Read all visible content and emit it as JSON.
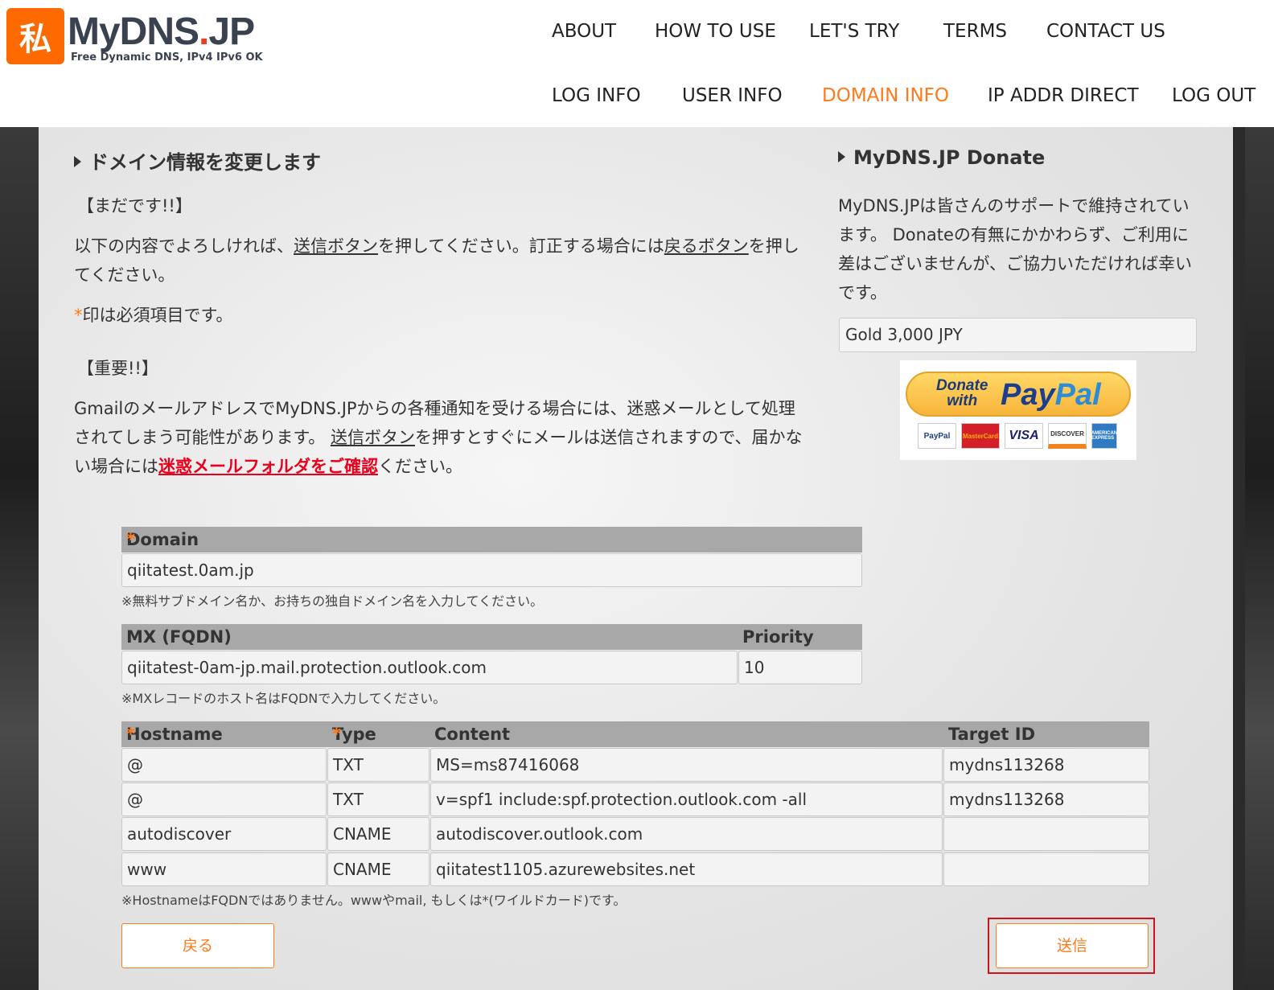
{
  "logo": {
    "mark": "私",
    "name": "MyDNS",
    "dot": ".",
    "tld": "JP",
    "tagline": "Free Dynamic DNS, IPv4 IPv6 OK"
  },
  "nav_top": [
    "ABOUT",
    "HOW TO USE",
    "LET'S TRY",
    "TERMS",
    "CONTACT US"
  ],
  "nav_bottom": [
    "LOG INFO",
    "USER INFO",
    "DOMAIN INFO",
    "IP ADDR DIRECT",
    "LOG OUT"
  ],
  "nav_active": "DOMAIN INFO",
  "left": {
    "heading": "ドメイン情報を変更します",
    "notice1": "【まだです!!】",
    "para1_a": "以下の内容でよろしければ、",
    "para1_link1": "送信ボタン",
    "para1_b": "を押してください。訂正する場合には",
    "para1_link2": "戻るボタン",
    "para1_c": "を押してください。",
    "required_star": "*",
    "required_note": "印は必須項目です。",
    "notice2": "【重要!!】",
    "para2_a": "GmailのメールアドレスでMyDNS.JPからの各種通知を受ける場合には、迷惑メールとして処理されてしまう可能性があります。 ",
    "para2_link": "送信ボタン",
    "para2_b": "を押すとすぐにメールは送信されますので、届かない場合には",
    "para2_red": "迷惑メールフォルダをご確認",
    "para2_c": "ください。"
  },
  "right": {
    "heading": "MyDNS.JP Donate",
    "text": "MyDNS.JPは皆さんのサポートで維持されています。 Donateの有無にかかわらず、ご利用に差はございませんが、ご協力いただければ幸いです。",
    "select_value": "Gold 3,000 JPY",
    "paypal_donate": "Donate",
    "paypal_with": "with",
    "paypal_pay": "Pay",
    "paypal_pal": "Pal",
    "cards": [
      "PayPal",
      "MasterCard",
      "VISA",
      "DISCOVER",
      "AMERICAN EXPRESS"
    ]
  },
  "form": {
    "domain_label": "Domain",
    "domain_value": "qiitatest.0am.jp",
    "domain_note": "※無料サブドメイン名か、お持ちの独自ドメイン名を入力してください。",
    "mx_label": "MX (FQDN)",
    "priority_label": "Priority",
    "mx_value": "qiitatest-0am-jp.mail.protection.outlook.com",
    "priority_value": "10",
    "mx_note": "※MXレコードのホスト名はFQDNで入力してください。",
    "col_hostname": "Hostname",
    "col_type": "Type",
    "col_content": "Content",
    "col_target": "Target ID",
    "records": [
      {
        "hostname": "@",
        "type": "TXT",
        "content": "MS=ms87416068",
        "target": "mydns113268"
      },
      {
        "hostname": "@",
        "type": "TXT",
        "content": "v=spf1 include:spf.protection.outlook.com -all",
        "target": "mydns113268"
      },
      {
        "hostname": "autodiscover",
        "type": "CNAME",
        "content": "autodiscover.outlook.com",
        "target": ""
      },
      {
        "hostname": "www",
        "type": "CNAME",
        "content": "qiitatest1105.azurewebsites.net",
        "target": ""
      }
    ],
    "host_note": "※HostnameはFQDNではありません。wwwやmail, もしくは*(ワイルドカード)です。",
    "back_label": "戻る",
    "submit_label": "送信"
  }
}
